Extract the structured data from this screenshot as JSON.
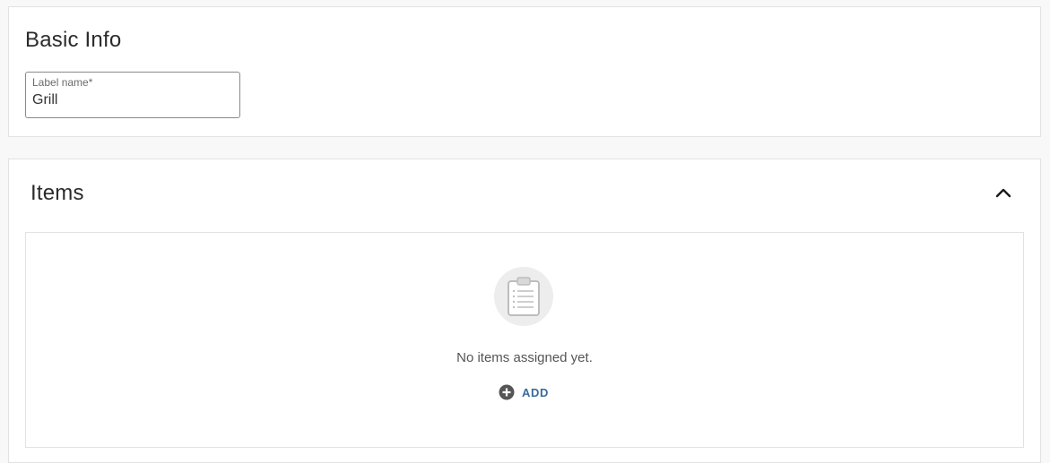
{
  "basic_info": {
    "title": "Basic Info",
    "label_field": {
      "label": "Label name*",
      "value": "Grill"
    }
  },
  "items": {
    "title": "Items",
    "collapse_icon": "chevron-up-icon",
    "empty_state": {
      "icon": "clipboard-list-icon",
      "message": "No items assigned yet.",
      "add_icon": "plus-circle-icon",
      "add_label": "ADD"
    }
  },
  "colors": {
    "background": "#f8f8f8",
    "card": "#ffffff",
    "border": "#e2e2e2",
    "link": "#3a6b9c",
    "icon_bg": "#ededed"
  }
}
